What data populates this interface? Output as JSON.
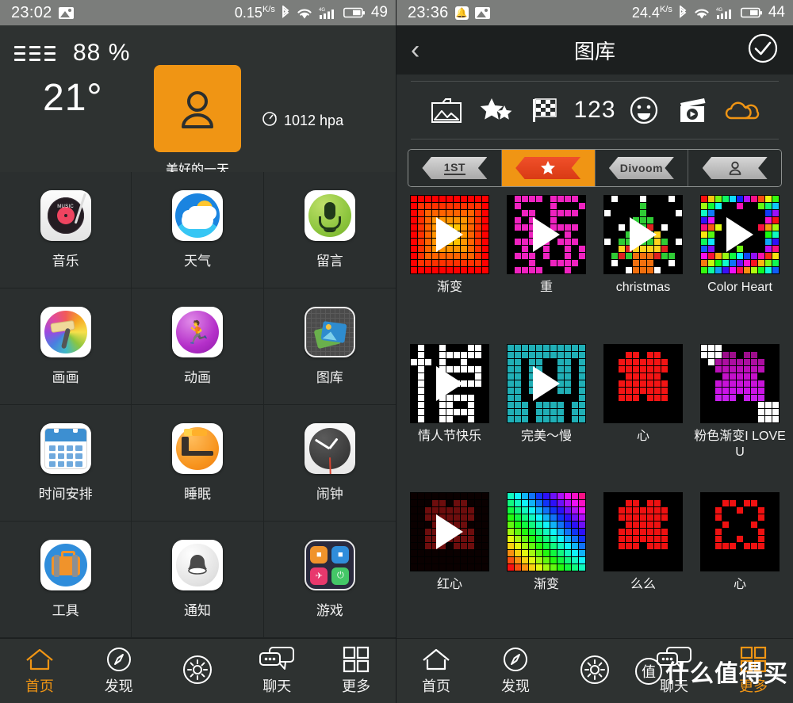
{
  "left": {
    "statusbar": {
      "time": "23:02",
      "network_speed": "0.15",
      "network_unit": "K/s",
      "battery": "49",
      "icons": [
        "image-icon",
        "bluetooth-icon",
        "wifi-icon",
        "signal-icon",
        "battery-icon"
      ]
    },
    "weather": {
      "humidity": "88 %",
      "temperature": "21°",
      "pressure": "1012 hpa",
      "mood_label": "美好的一天",
      "mood_color": "#f09514"
    },
    "apps": [
      {
        "label": "音乐",
        "icon": "music-icon"
      },
      {
        "label": "天气",
        "icon": "weather-icon"
      },
      {
        "label": "留言",
        "icon": "microphone-icon"
      },
      {
        "label": "画画",
        "icon": "paint-icon"
      },
      {
        "label": "动画",
        "icon": "animation-icon"
      },
      {
        "label": "图库",
        "icon": "gallery-icon"
      },
      {
        "label": "时间安排",
        "icon": "calendar-icon"
      },
      {
        "label": "睡眠",
        "icon": "sleep-icon"
      },
      {
        "label": "闹钟",
        "icon": "alarm-clock-icon"
      },
      {
        "label": "工具",
        "icon": "tools-icon"
      },
      {
        "label": "通知",
        "icon": "bell-icon"
      },
      {
        "label": "游戏",
        "icon": "games-icon"
      }
    ],
    "nav": [
      {
        "label": "首页",
        "icon": "home-icon",
        "active": true
      },
      {
        "label": "发现",
        "icon": "compass-icon",
        "active": false
      },
      {
        "label": "",
        "icon": "brightness-icon",
        "active": false
      },
      {
        "label": "聊天",
        "icon": "chat-icon",
        "active": false
      },
      {
        "label": "更多",
        "icon": "grid-icon",
        "active": false
      }
    ]
  },
  "right": {
    "statusbar": {
      "time": "23:36",
      "network_speed": "24.4",
      "network_unit": "K/s",
      "battery": "44",
      "icons": [
        "bell-icon",
        "image-icon",
        "bluetooth-icon",
        "wifi-icon",
        "signal-icon",
        "battery-icon"
      ]
    },
    "appbar": {
      "title": "图库",
      "back": "back-chevron-icon",
      "confirm": "check-circle-icon"
    },
    "categories": [
      {
        "name": "photo-folder-icon"
      },
      {
        "name": "stars-icon"
      },
      {
        "name": "checkered-flag-icon"
      },
      {
        "name": "numbers-icon",
        "label": "123"
      },
      {
        "name": "smiley-icon"
      },
      {
        "name": "video-clapboard-icon"
      },
      {
        "name": "cloud-icon",
        "color": "#f09514"
      }
    ],
    "tabs": [
      {
        "label": "1ST",
        "active": false
      },
      {
        "label": "star-icon",
        "active": true
      },
      {
        "label": "Divoom",
        "active": false
      },
      {
        "label": "person-icon",
        "active": false
      }
    ],
    "gallery": [
      {
        "caption": "渐变",
        "art": "gradient-warm",
        "play": true
      },
      {
        "caption": "重",
        "art": "magenta-glyph",
        "play": true
      },
      {
        "caption": "christmas",
        "art": "christmas-tree",
        "play": true
      },
      {
        "caption": "Color Heart",
        "art": "rainbow-heart",
        "play": true
      },
      {
        "caption": "情人节快乐",
        "art": "white-glyph",
        "play": true
      },
      {
        "caption": "完美～慢",
        "art": "teal-glyph",
        "play": true
      },
      {
        "caption": "心",
        "art": "red-heart",
        "play": false
      },
      {
        "caption": "粉色渐变I LOVE U",
        "art": "pink-heart",
        "play": false
      },
      {
        "caption": "红心",
        "art": "dark-red-heart",
        "play": true
      },
      {
        "caption": "渐变",
        "art": "rainbow-diagonal",
        "play": false
      },
      {
        "caption": "么么",
        "art": "red-heart-2",
        "play": false
      },
      {
        "caption": "心",
        "art": "heart-outline",
        "play": false
      }
    ],
    "nav": [
      {
        "label": "首页",
        "icon": "home-icon",
        "active": false
      },
      {
        "label": "发现",
        "icon": "compass-icon",
        "active": false
      },
      {
        "label": "",
        "icon": "brightness-icon",
        "active": false
      },
      {
        "label": "聊天",
        "icon": "chat-icon",
        "active": false
      },
      {
        "label": "更多",
        "icon": "grid-icon",
        "active": true
      }
    ],
    "watermark": {
      "logo": "值",
      "text": "什么值得买"
    }
  }
}
